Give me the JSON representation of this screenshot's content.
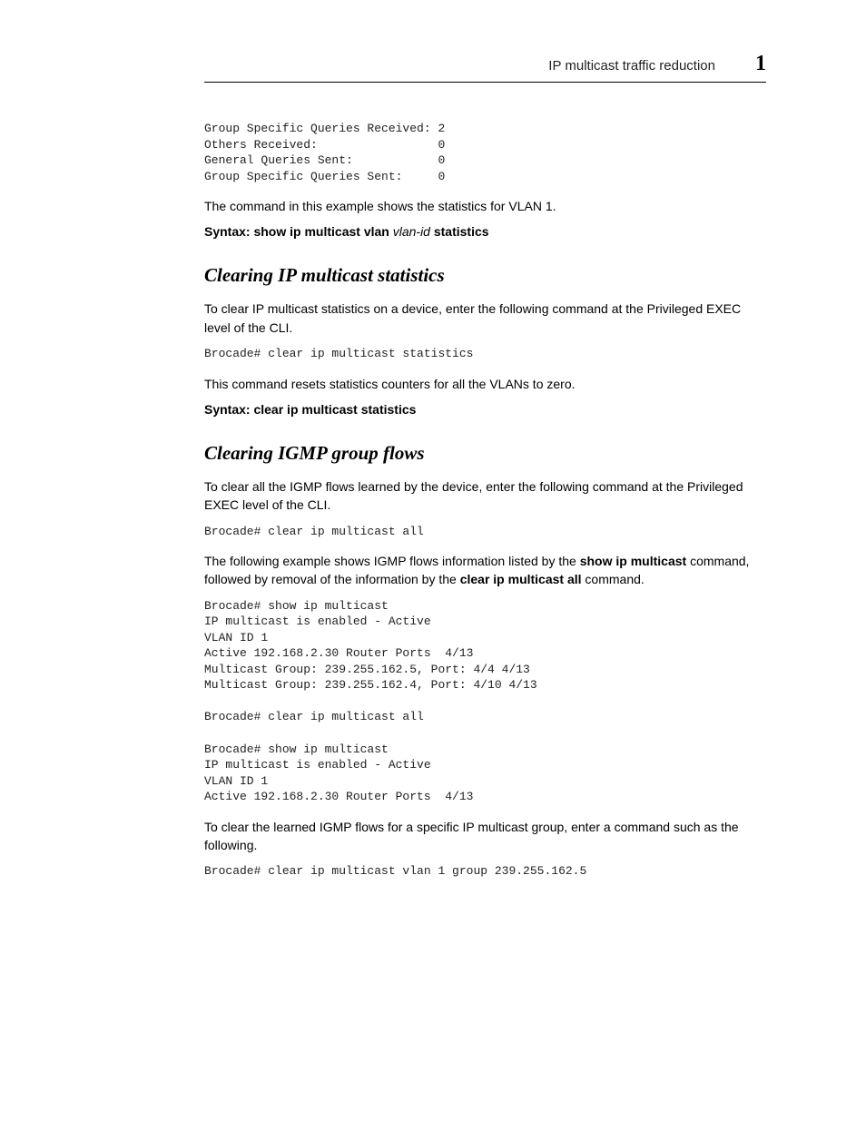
{
  "header": {
    "title": "IP multicast traffic reduction",
    "chapter": "1"
  },
  "stats_block": "Group Specific Queries Received: 2\nOthers Received:                 0\nGeneral Queries Sent:            0\nGroup Specific Queries Sent:     0",
  "intro_after_stats": "The command in this example shows the statistics for VLAN 1.",
  "syntax1": {
    "prefix": "Syntax:  show ip multicast vlan",
    "var": "vlan-id",
    "suffix": "statistics"
  },
  "section1": {
    "heading": "Clearing IP multicast statistics",
    "p1": "To clear IP multicast statistics on a device, enter the following command at the Privileged EXEC level of the CLI.",
    "code": "Brocade# clear ip multicast statistics",
    "p2": "This command resets statistics counters for all the VLANs to zero.",
    "syntax": "Syntax:  clear ip multicast statistics"
  },
  "section2": {
    "heading": "Clearing IGMP group flows",
    "p1": "To clear all the IGMP flows learned by the device, enter the following command at the Privileged EXEC level of the CLI.",
    "code1": "Brocade# clear ip multicast all",
    "p2_pre": "The following example shows IGMP flows information listed by the ",
    "p2_cmd1": "show ip multicast",
    "p2_mid": " command, followed by removal of the information by the ",
    "p2_cmd2": "clear ip multicast all",
    "p2_post": " command.",
    "code2": "Brocade# show ip multicast\nIP multicast is enabled - Active\nVLAN ID 1\nActive 192.168.2.30 Router Ports  4/13\nMulticast Group: 239.255.162.5, Port: 4/4 4/13\nMulticast Group: 239.255.162.4, Port: 4/10 4/13\n\nBrocade# clear ip multicast all\n\nBrocade# show ip multicast\nIP multicast is enabled - Active\nVLAN ID 1\nActive 192.168.2.30 Router Ports  4/13",
    "p3": "To clear the learned IGMP flows for a specific IP multicast group, enter a command such as the following.",
    "code3": "Brocade# clear ip multicast vlan 1 group 239.255.162.5"
  }
}
